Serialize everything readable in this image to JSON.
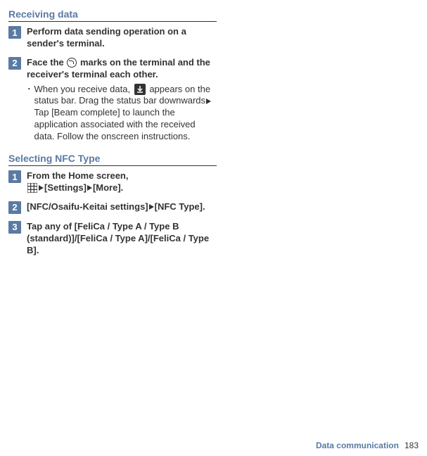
{
  "section1": {
    "heading": "Receiving data",
    "step1": {
      "num": "1",
      "title": "Perform data sending operation on a sender's terminal."
    },
    "step2": {
      "num": "2",
      "title_a": "Face the ",
      "title_b": " marks on the terminal and the receiver's terminal each other.",
      "bullet_a": "When you receive data, ",
      "bullet_b": " appears on the status bar. Drag the status bar downwards",
      "bullet_c": "Tap [Beam complete] to launch the application associated with the received data. Follow the onscreen instructions."
    }
  },
  "section2": {
    "heading": "Selecting NFC Type",
    "step1": {
      "num": "1",
      "title_a": "From the Home screen, ",
      "title_b": "[Settings]",
      "title_c": "[More]."
    },
    "step2": {
      "num": "2",
      "title_a": "[NFC/Osaifu-Keitai settings]",
      "title_b": "[NFC Type]."
    },
    "step3": {
      "num": "3",
      "title": "Tap any of [FeliCa / Type A / Type B (standard)]/[FeliCa / Type A]/[FeliCa / Type B]."
    }
  },
  "footer": {
    "label": "Data communication",
    "page": "183"
  }
}
